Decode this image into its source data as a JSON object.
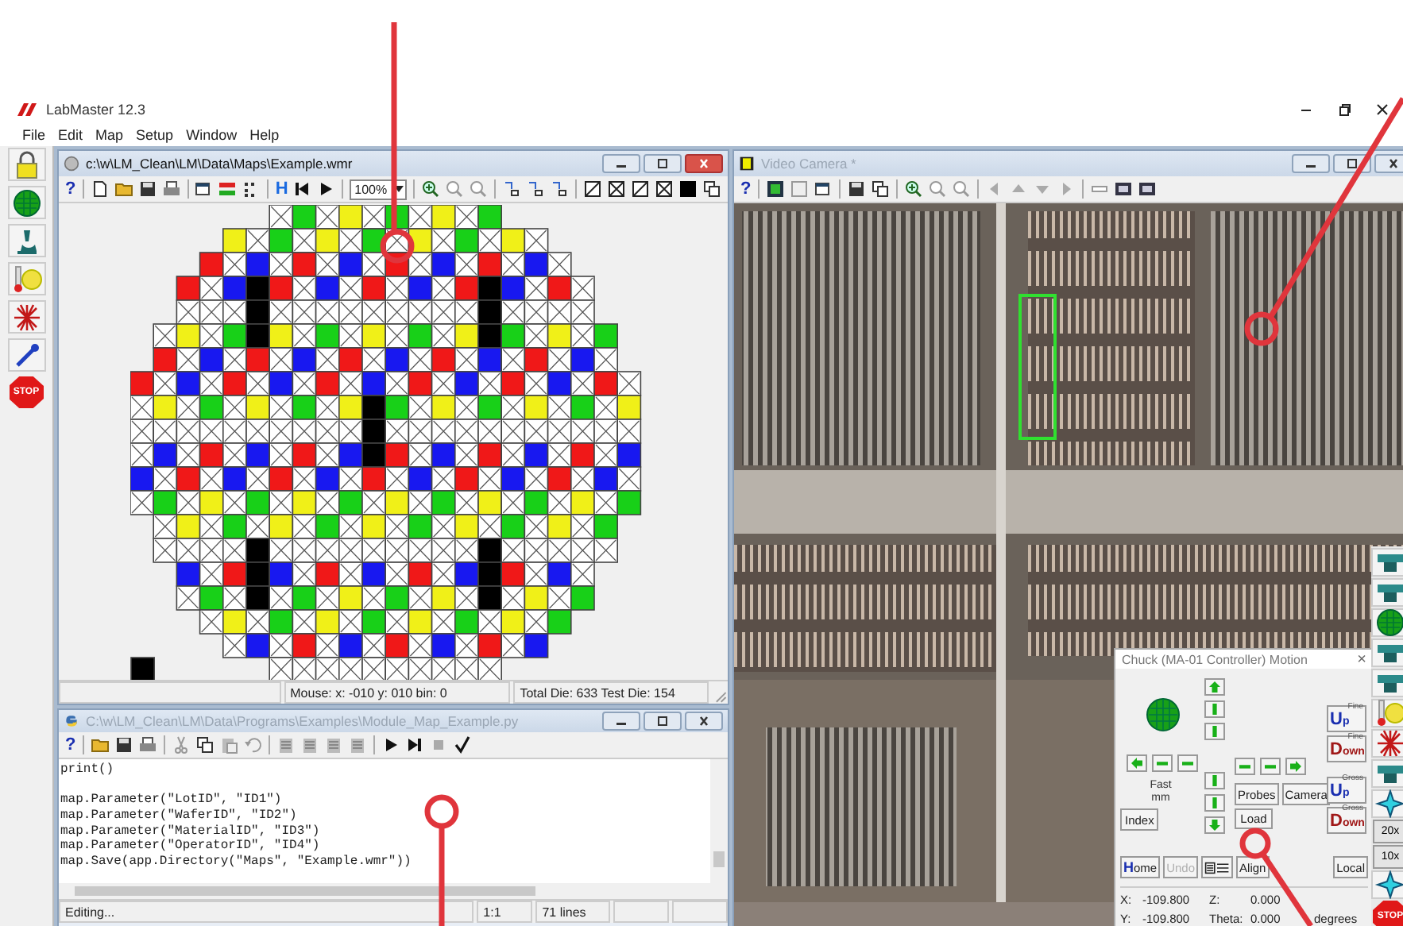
{
  "app": {
    "title": "LabMaster 12.3"
  },
  "menu": [
    "File",
    "Edit",
    "Map",
    "Setup",
    "Window",
    "Help"
  ],
  "left_toolbar": [
    {
      "kind": "lock"
    },
    {
      "kind": "globe"
    },
    {
      "kind": "microscope"
    },
    {
      "kind": "thermo"
    },
    {
      "kind": "laser"
    },
    {
      "kind": "wrench"
    },
    {
      "kind": "stop",
      "label": "STOP"
    }
  ],
  "wafer_window": {
    "title": "c:\\w\\LM_Clean\\LM\\Data\\Maps\\Example.wmr",
    "active": true,
    "help": "?",
    "h_label": "H",
    "zoom": "100%",
    "status": [
      "Mouse: x: -010  y: 010   bin: 0",
      "Total Die: 633  Test Die: 154"
    ]
  },
  "script_window": {
    "title": "C:\\w\\LM_Clean\\LM\\Data\\Programs\\Examples\\Module_Map_Example.py",
    "active": false,
    "help": "?",
    "code_blocks": [
      [
        "print()"
      ],
      [
        "map.Parameter(\"LotID\", \"ID1\")",
        "map.Parameter(\"WaferID\", \"ID2\")",
        "map.Parameter(\"MaterialID\", \"ID3\")",
        "map.Parameter(\"OperatorID\", \"ID4\")",
        "map.Save(app.Directory(\"Maps\", \"Example.wmr\"))"
      ]
    ],
    "status": {
      "message": "Editing...",
      "position": "1:1",
      "lines": "71 lines"
    }
  },
  "camera_window": {
    "title": "Video Camera *",
    "active": false,
    "help": "?"
  },
  "chuck_panel": {
    "title": "Chuck (MA-01 Controller) Motion",
    "close": "×",
    "speed": "Fast",
    "unit": "mm",
    "probes": "Probes",
    "camera": "Camera",
    "index": "Index",
    "load": "Load",
    "home": "Home",
    "undo": {
      "label": "Undo",
      "disabled": true
    },
    "align": "Align",
    "local": "Local",
    "z_buttons": [
      {
        "label": "Up",
        "tag": "Fine"
      },
      {
        "label": "Down",
        "tag": "Fine"
      },
      {
        "label": "Up",
        "tag": "Gross"
      },
      {
        "label": "Down",
        "tag": "Gross"
      }
    ],
    "readouts": [
      {
        "label": "X:",
        "value": "-109.800"
      },
      {
        "label": "Z:",
        "value": "0.000"
      },
      {
        "label": "Y:",
        "value": "-109.800"
      },
      {
        "label": "Theta:",
        "value": "0.000",
        "unit": "degrees"
      }
    ]
  },
  "right_toolbar": [
    {
      "kind": "stage"
    },
    {
      "kind": "stage"
    },
    {
      "kind": "globe"
    },
    {
      "kind": "stage"
    },
    {
      "kind": "stage"
    },
    {
      "kind": "thermo"
    },
    {
      "kind": "laser"
    },
    {
      "kind": "stage"
    },
    {
      "kind": "scope"
    },
    {
      "kind": "lens",
      "label": "20x"
    },
    {
      "kind": "lens",
      "label": "10x"
    },
    {
      "kind": "scope"
    },
    {
      "kind": "stop",
      "label": "STOP"
    }
  ]
}
